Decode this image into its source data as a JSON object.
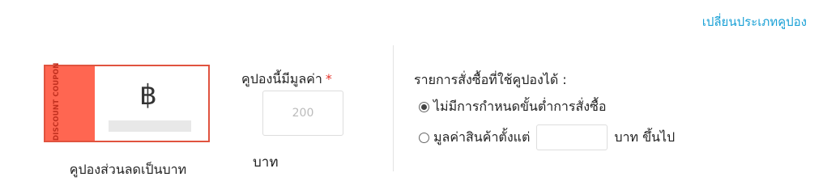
{
  "header": {
    "change_type_link": "เปลี่ยนประเภทคูปอง"
  },
  "coupon_card": {
    "strip_text": "DISCOUNT COUPON",
    "symbol": "฿",
    "caption": "คูปองส่วนลดเป็นบาท"
  },
  "value_field": {
    "label": "คูปองนี้มีมูลค่า",
    "required_mark": "*",
    "placeholder": "200",
    "value": "",
    "unit": "บาท"
  },
  "order_condition": {
    "title": "รายการสั่งซื้อที่ใช้คูปองได้ :",
    "options": [
      {
        "label": "ไม่มีการกำหนดขั้นต่ำการสั่งซื้อ",
        "selected": true
      },
      {
        "label": "มูลค่าสินค้าตั้งแต่",
        "selected": false,
        "min_value": "",
        "suffix": "บาท ขึ้นไป"
      }
    ]
  },
  "colors": {
    "link": "#1ba1d6",
    "coupon_red": "#ff6651",
    "coupon_border": "#e0533f",
    "required": "#e5332a"
  }
}
